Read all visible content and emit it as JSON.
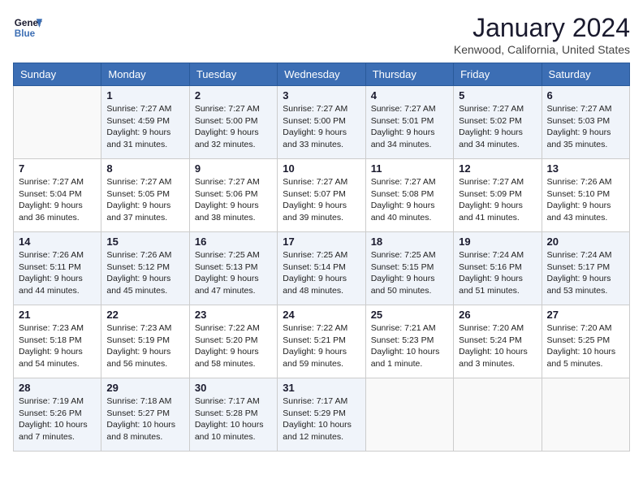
{
  "header": {
    "logo_line1": "General",
    "logo_line2": "Blue",
    "title": "January 2024",
    "subtitle": "Kenwood, California, United States"
  },
  "weekdays": [
    "Sunday",
    "Monday",
    "Tuesday",
    "Wednesday",
    "Thursday",
    "Friday",
    "Saturday"
  ],
  "weeks": [
    [
      {
        "num": "",
        "info": ""
      },
      {
        "num": "1",
        "info": "Sunrise: 7:27 AM\nSunset: 4:59 PM\nDaylight: 9 hours\nand 31 minutes."
      },
      {
        "num": "2",
        "info": "Sunrise: 7:27 AM\nSunset: 5:00 PM\nDaylight: 9 hours\nand 32 minutes."
      },
      {
        "num": "3",
        "info": "Sunrise: 7:27 AM\nSunset: 5:00 PM\nDaylight: 9 hours\nand 33 minutes."
      },
      {
        "num": "4",
        "info": "Sunrise: 7:27 AM\nSunset: 5:01 PM\nDaylight: 9 hours\nand 34 minutes."
      },
      {
        "num": "5",
        "info": "Sunrise: 7:27 AM\nSunset: 5:02 PM\nDaylight: 9 hours\nand 34 minutes."
      },
      {
        "num": "6",
        "info": "Sunrise: 7:27 AM\nSunset: 5:03 PM\nDaylight: 9 hours\nand 35 minutes."
      }
    ],
    [
      {
        "num": "7",
        "info": "Sunrise: 7:27 AM\nSunset: 5:04 PM\nDaylight: 9 hours\nand 36 minutes."
      },
      {
        "num": "8",
        "info": "Sunrise: 7:27 AM\nSunset: 5:05 PM\nDaylight: 9 hours\nand 37 minutes."
      },
      {
        "num": "9",
        "info": "Sunrise: 7:27 AM\nSunset: 5:06 PM\nDaylight: 9 hours\nand 38 minutes."
      },
      {
        "num": "10",
        "info": "Sunrise: 7:27 AM\nSunset: 5:07 PM\nDaylight: 9 hours\nand 39 minutes."
      },
      {
        "num": "11",
        "info": "Sunrise: 7:27 AM\nSunset: 5:08 PM\nDaylight: 9 hours\nand 40 minutes."
      },
      {
        "num": "12",
        "info": "Sunrise: 7:27 AM\nSunset: 5:09 PM\nDaylight: 9 hours\nand 41 minutes."
      },
      {
        "num": "13",
        "info": "Sunrise: 7:26 AM\nSunset: 5:10 PM\nDaylight: 9 hours\nand 43 minutes."
      }
    ],
    [
      {
        "num": "14",
        "info": "Sunrise: 7:26 AM\nSunset: 5:11 PM\nDaylight: 9 hours\nand 44 minutes."
      },
      {
        "num": "15",
        "info": "Sunrise: 7:26 AM\nSunset: 5:12 PM\nDaylight: 9 hours\nand 45 minutes."
      },
      {
        "num": "16",
        "info": "Sunrise: 7:25 AM\nSunset: 5:13 PM\nDaylight: 9 hours\nand 47 minutes."
      },
      {
        "num": "17",
        "info": "Sunrise: 7:25 AM\nSunset: 5:14 PM\nDaylight: 9 hours\nand 48 minutes."
      },
      {
        "num": "18",
        "info": "Sunrise: 7:25 AM\nSunset: 5:15 PM\nDaylight: 9 hours\nand 50 minutes."
      },
      {
        "num": "19",
        "info": "Sunrise: 7:24 AM\nSunset: 5:16 PM\nDaylight: 9 hours\nand 51 minutes."
      },
      {
        "num": "20",
        "info": "Sunrise: 7:24 AM\nSunset: 5:17 PM\nDaylight: 9 hours\nand 53 minutes."
      }
    ],
    [
      {
        "num": "21",
        "info": "Sunrise: 7:23 AM\nSunset: 5:18 PM\nDaylight: 9 hours\nand 54 minutes."
      },
      {
        "num": "22",
        "info": "Sunrise: 7:23 AM\nSunset: 5:19 PM\nDaylight: 9 hours\nand 56 minutes."
      },
      {
        "num": "23",
        "info": "Sunrise: 7:22 AM\nSunset: 5:20 PM\nDaylight: 9 hours\nand 58 minutes."
      },
      {
        "num": "24",
        "info": "Sunrise: 7:22 AM\nSunset: 5:21 PM\nDaylight: 9 hours\nand 59 minutes."
      },
      {
        "num": "25",
        "info": "Sunrise: 7:21 AM\nSunset: 5:23 PM\nDaylight: 10 hours\nand 1 minute."
      },
      {
        "num": "26",
        "info": "Sunrise: 7:20 AM\nSunset: 5:24 PM\nDaylight: 10 hours\nand 3 minutes."
      },
      {
        "num": "27",
        "info": "Sunrise: 7:20 AM\nSunset: 5:25 PM\nDaylight: 10 hours\nand 5 minutes."
      }
    ],
    [
      {
        "num": "28",
        "info": "Sunrise: 7:19 AM\nSunset: 5:26 PM\nDaylight: 10 hours\nand 7 minutes."
      },
      {
        "num": "29",
        "info": "Sunrise: 7:18 AM\nSunset: 5:27 PM\nDaylight: 10 hours\nand 8 minutes."
      },
      {
        "num": "30",
        "info": "Sunrise: 7:17 AM\nSunset: 5:28 PM\nDaylight: 10 hours\nand 10 minutes."
      },
      {
        "num": "31",
        "info": "Sunrise: 7:17 AM\nSunset: 5:29 PM\nDaylight: 10 hours\nand 12 minutes."
      },
      {
        "num": "",
        "info": ""
      },
      {
        "num": "",
        "info": ""
      },
      {
        "num": "",
        "info": ""
      }
    ]
  ]
}
